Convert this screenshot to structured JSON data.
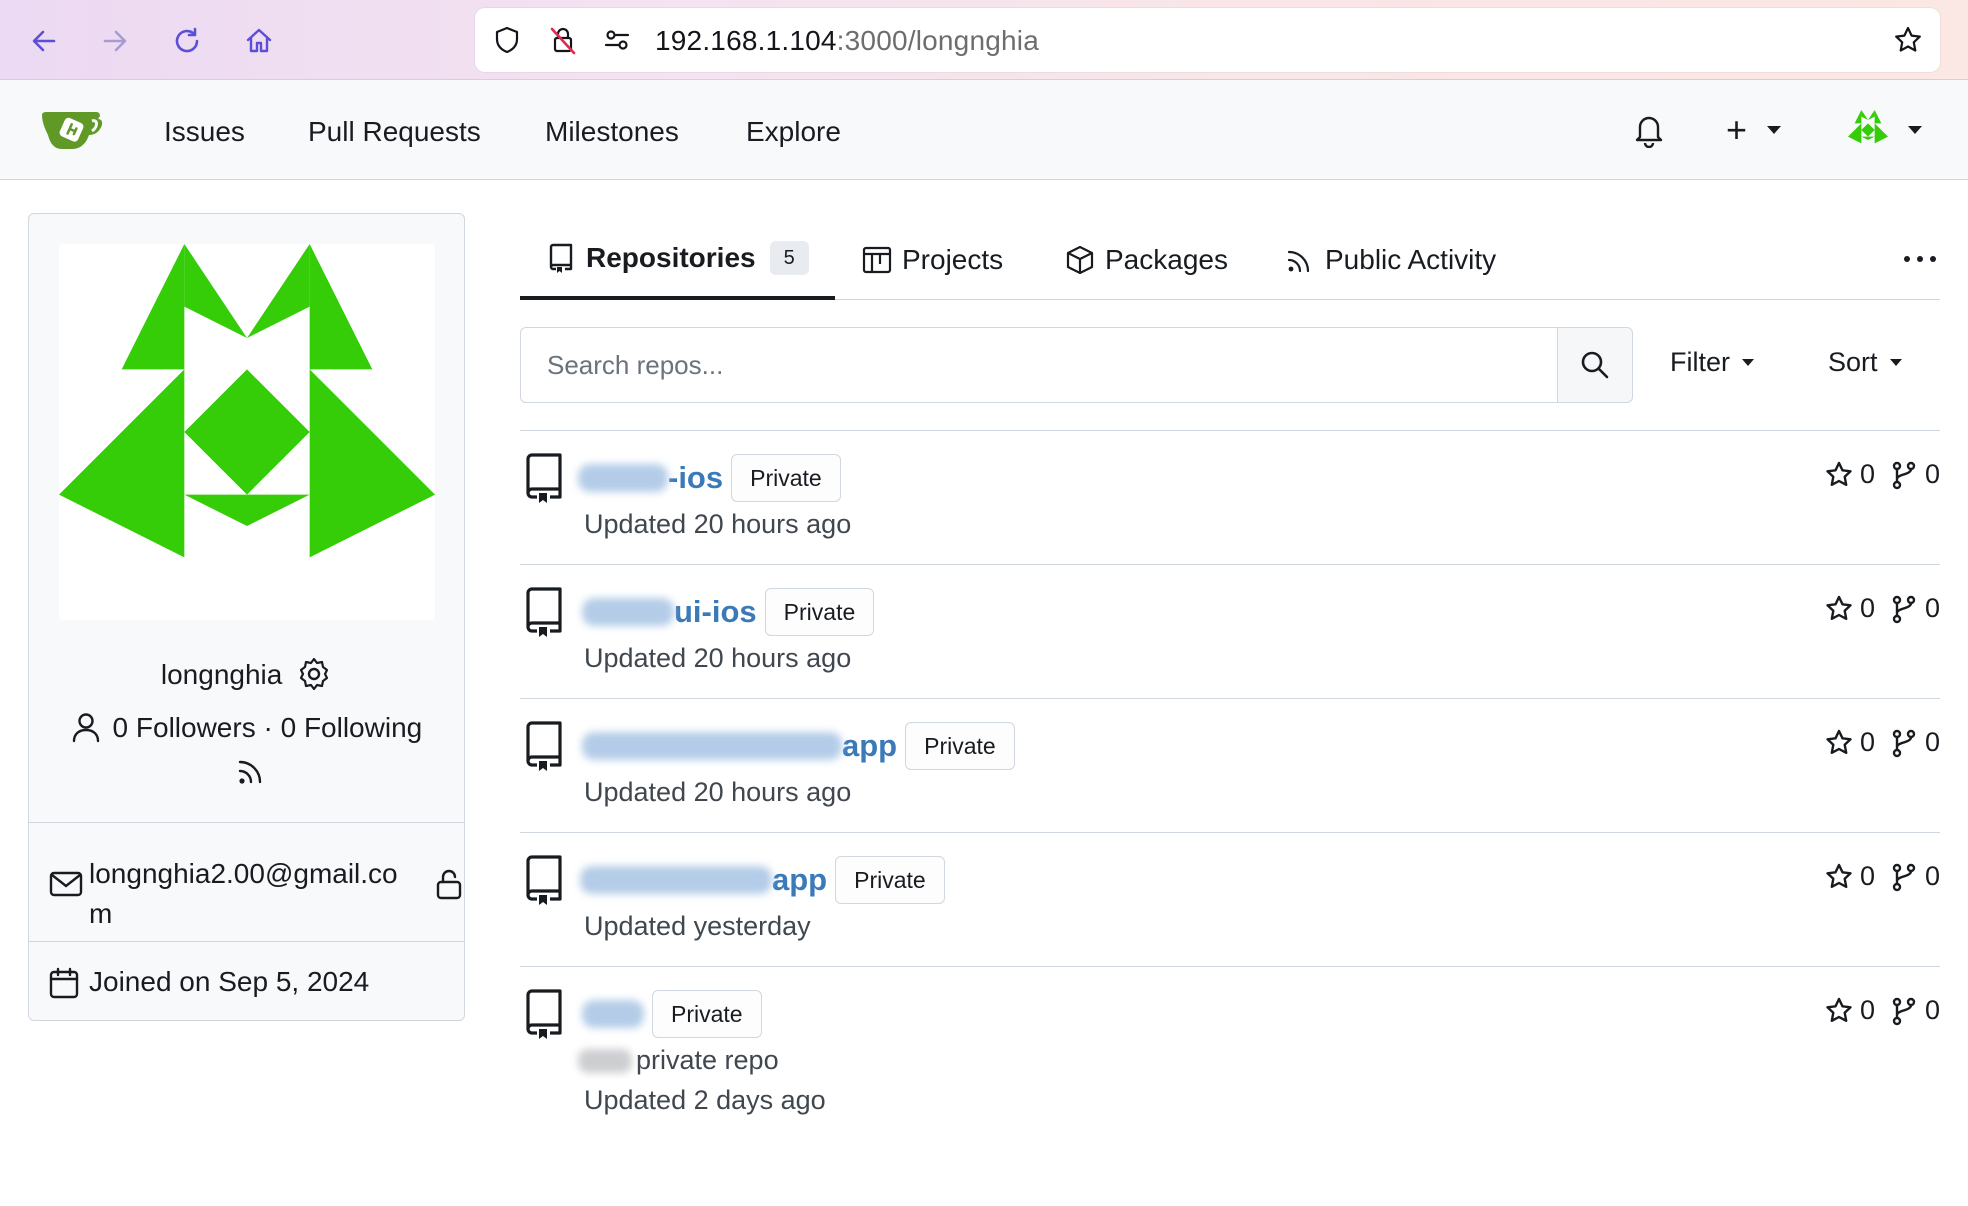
{
  "browser": {
    "url_host": "192.168.1.104",
    "url_path": ":3000/longnghia"
  },
  "navbar": {
    "links": [
      "Issues",
      "Pull Requests",
      "Milestones",
      "Explore"
    ],
    "add_label": "+",
    "logo_color": "#609926"
  },
  "profile": {
    "username": "longnghia",
    "followers_text": "0 Followers · 0 Following",
    "email": "longnghia2.00@gmail.com",
    "joined": "Joined on Sep 5, 2024",
    "avatar_color": "#35cc08"
  },
  "tabs": {
    "repositories": "Repositories",
    "repositories_count": "5",
    "projects": "Projects",
    "packages": "Packages",
    "public_activity": "Public Activity"
  },
  "search": {
    "placeholder": "Search repos...",
    "filter_label": "Filter",
    "sort_label": "Sort"
  },
  "repos": [
    {
      "name_suffix": "-ios",
      "badge": "Private",
      "description": "",
      "updated": "Updated 20 hours ago",
      "stars": "0",
      "forks": "0"
    },
    {
      "name_suffix": "ui-ios",
      "badge": "Private",
      "description": "",
      "updated": "Updated 20 hours ago",
      "stars": "0",
      "forks": "0"
    },
    {
      "name_suffix": "app",
      "badge": "Private",
      "description": "",
      "updated": "Updated 20 hours ago",
      "stars": "0",
      "forks": "0"
    },
    {
      "name_suffix": "app",
      "badge": "Private",
      "description": "",
      "updated": "Updated yesterday",
      "stars": "0",
      "forks": "0"
    },
    {
      "name_suffix": "",
      "badge": "Private",
      "description": "private repo",
      "updated": "Updated 2 days ago",
      "stars": "0",
      "forks": "0"
    }
  ],
  "colors": {
    "link_blue": "#3a7ab8",
    "border": "#d0d7de"
  }
}
